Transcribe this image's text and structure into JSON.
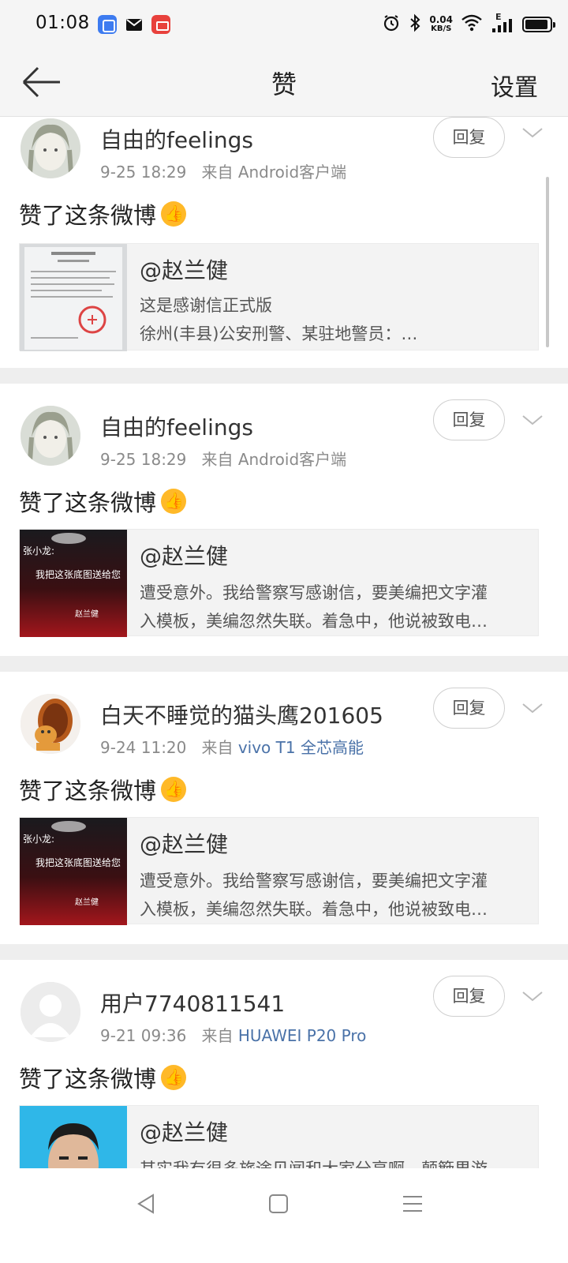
{
  "status_bar": {
    "time": "01:08",
    "speed_value": "0.04",
    "speed_unit": "KB/S",
    "network": "E"
  },
  "nav": {
    "title": "赞",
    "settings": "设置"
  },
  "items": [
    {
      "username": "自由的feelings",
      "time": "9-25 18:29",
      "from": "来自",
      "source": "Android客户端",
      "reply": "回复",
      "action": "赞了这条微博",
      "quote_author": "@赵兰健",
      "quote_line1": "这是感谢信正式版",
      "quote_line2": "徐州(丰县)公安刑警、某驻地警员：…"
    },
    {
      "username": "自由的feelings",
      "time": "9-25 18:29",
      "from": "来自",
      "source": "Android客户端",
      "reply": "回复",
      "action": "赞了这条微博",
      "quote_author": "@赵兰健",
      "quote_line1": "遭受意外。我给警察写感谢信，要美编把文字灌",
      "quote_line2": "入模板，美编忽然失联。着急中，他说被致电…",
      "thumb_text1": "张小龙:",
      "thumb_text2": "我把这张底图送给您",
      "thumb_text3": "赵兰健"
    },
    {
      "username": "白天不睡觉的猫头鹰201605",
      "time": "9-24 11:20",
      "from": "来自",
      "source": "vivo T1 全芯高能",
      "reply": "回复",
      "action": "赞了这条微博",
      "quote_author": "@赵兰健",
      "quote_line1": "遭受意外。我给警察写感谢信，要美编把文字灌",
      "quote_line2": "入模板，美编忽然失联。着急中，他说被致电…",
      "thumb_text1": "张小龙:",
      "thumb_text2": "我把这张底图送给您",
      "thumb_text3": "赵兰健"
    },
    {
      "username": "用户7740811541",
      "time": "9-21 09:36",
      "from": "来自",
      "source": "HUAWEI P20 Pro",
      "reply": "回复",
      "action": "赞了这条微博",
      "quote_author": "@赵兰健",
      "quote_line1": "其实我有很多旅途见闻和大家分享啊，颠簸果游"
    }
  ]
}
